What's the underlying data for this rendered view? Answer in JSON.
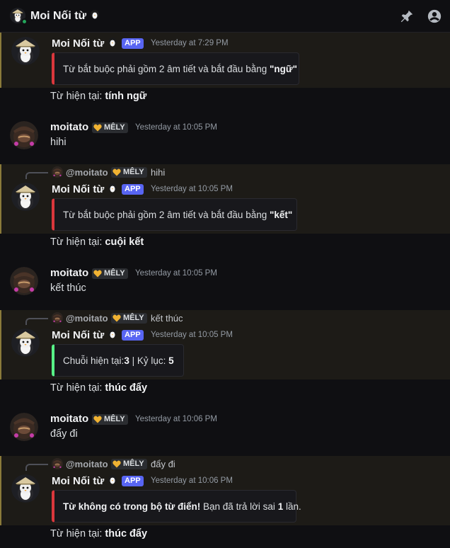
{
  "header": {
    "title": "Moi Nối từ",
    "title_emoji": "penguin-icon"
  },
  "bot": {
    "name": "Moi Nối từ",
    "tag": "APP"
  },
  "user": {
    "name": "moitato",
    "tag": "MÊLY",
    "mention": "@moitato"
  },
  "messages": [
    {
      "type": "bot",
      "time": "Yesterday at 7:29 PM",
      "embed": {
        "pre": "Từ bắt buộc phải gồm 2 âm tiết và bắt đầu bằng ",
        "bold": "\"ngữ\"",
        "post": ""
      },
      "current_label": "Từ hiện tại: ",
      "current_word": "tính ngữ"
    },
    {
      "type": "user",
      "time": "Yesterday at 10:05 PM",
      "text": "hihi"
    },
    {
      "type": "bot",
      "time": "Yesterday at 10:05 PM",
      "reply_text": "hihi",
      "embed": {
        "pre": "Từ bắt buộc phải gồm 2 âm tiết và bắt đầu bằng ",
        "bold": "\"kết\"",
        "post": ""
      },
      "current_label": "Từ hiện tại: ",
      "current_word": "cuội kết"
    },
    {
      "type": "user",
      "time": "Yesterday at 10:05 PM",
      "text": "kết thúc"
    },
    {
      "type": "bot",
      "time": "Yesterday at 10:05 PM",
      "reply_text": "kết thúc",
      "embed": {
        "pre": "Chuỗi hiện tại: ",
        "bold": "3",
        "mid": " | Kỷ lục: ",
        "bold2": "5"
      },
      "current_label": "Từ hiện tại: ",
      "current_word": "thúc đẩy"
    },
    {
      "type": "user",
      "time": "Yesterday at 10:06 PM",
      "text": "đẩy đi"
    },
    {
      "type": "bot",
      "time": "Yesterday at 10:06 PM",
      "reply_text": "đẩy đi",
      "embed": {
        "bold": "Từ không có trong bộ từ điển!",
        "mid": " Bạn đã trả lời sai ",
        "bold2": "1",
        "post": " lần."
      },
      "current_label": "Từ hiện tại: ",
      "current_word": "thúc đẩy"
    }
  ],
  "colors": {
    "app_tag": "#5865f2",
    "embed_error": "#da373c",
    "embed_success": "#57f287",
    "online": "#23a55a"
  }
}
